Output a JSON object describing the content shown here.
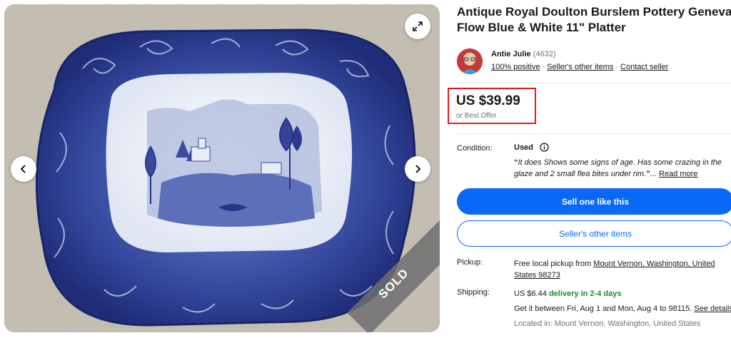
{
  "gallery": {
    "sold_label": "SOLD",
    "expand_icon": "expand-arrows-icon",
    "prev_icon": "chevron-left-icon",
    "next_icon": "chevron-right-icon"
  },
  "listing": {
    "title": "Antique Royal Doulton Burslem Pottery Geneva Flow Blue & White 11\" Platter"
  },
  "seller": {
    "name": "Antie Julie",
    "feedback_count": "(4632)",
    "positive": "100% positive",
    "other_items": "Seller's other items",
    "contact": "Contact seller"
  },
  "price": {
    "amount": "US $39.99",
    "offer": "or Best Offer"
  },
  "condition": {
    "label": "Condition:",
    "value": "Used",
    "desc_open": "“",
    "description": "It does Shows some signs of age. Has some crazing in the glaze and 2 small flea bites under rim.",
    "desc_close": "”",
    "ellipsis": "...",
    "read_more": "Read more"
  },
  "actions": {
    "sell_one": "Sell one like this",
    "seller_items": "Seller's other items"
  },
  "pickup": {
    "label": "Pickup:",
    "text": "Free local pickup from",
    "location": "Mount Vernon, Washington, United States 98273"
  },
  "shipping": {
    "label": "Shipping:",
    "cost": "US $6.44",
    "delivery": "delivery in 2-4 days",
    "estimate": "Get it between Fri, Aug 1 and Mon, Aug 4 to 98115.",
    "details_link": "See details",
    "located": "Located in: Mount Vernon, Washington, United States"
  },
  "colors": {
    "primary_blue": "#0968f6",
    "highlight_red": "#e01b1b",
    "delivery_green": "#1c8b2c",
    "platter_blue": "#2e3f93"
  }
}
